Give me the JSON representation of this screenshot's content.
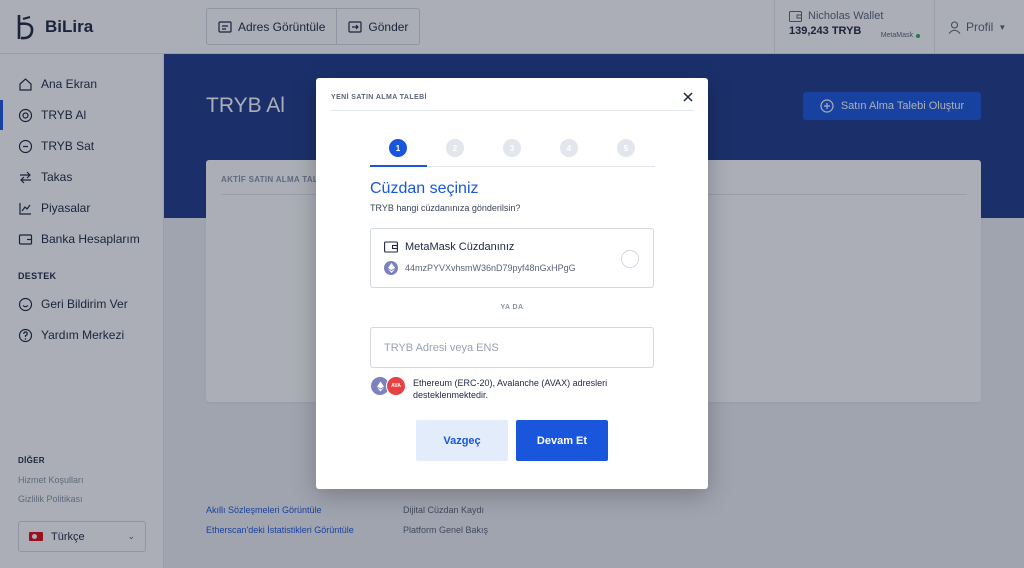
{
  "brand": {
    "name": "BiLira"
  },
  "header": {
    "actions": [
      {
        "label": "Adres Görüntüle",
        "icon": "address-card-icon"
      },
      {
        "label": "Gönder",
        "icon": "send-icon"
      }
    ],
    "wallet": {
      "name": "Nicholas Wallet",
      "balance": "139,243 TRYB",
      "network": "MetaMask",
      "status_color": "#22b35e"
    },
    "profile_label": "Profil"
  },
  "sidebar": {
    "items": [
      {
        "label": "Ana Ekran",
        "icon": "home-icon"
      },
      {
        "label": "TRYB Al",
        "icon": "buy-icon",
        "active": true
      },
      {
        "label": "TRYB Sat",
        "icon": "sell-icon"
      },
      {
        "label": "Takas",
        "icon": "swap-icon"
      },
      {
        "label": "Piyasalar",
        "icon": "chart-icon"
      },
      {
        "label": "Banka Hesaplarım",
        "icon": "wallet-icon"
      }
    ],
    "support_heading": "DESTEK",
    "support_items": [
      {
        "label": "Geri Bildirim Ver",
        "icon": "feedback-icon"
      },
      {
        "label": "Yardım Merkezi",
        "icon": "help-icon"
      }
    ],
    "other_heading": "DİĞER",
    "other_links": [
      "Hizmet Koşulları",
      "Gizlilik Politikası"
    ],
    "language": "Türkçe"
  },
  "main": {
    "title": "TRYB Al",
    "create_button": "Satın Alma Talebi Oluştur",
    "card_heading": "AKTİF SATIN ALMA TAL",
    "footer_left": [
      "Akıllı Sözleşmeleri Görüntüle",
      "Etherscan'deki İstatistikleri Görüntüle"
    ],
    "footer_right": [
      "Dijital Cüzdan Kaydı",
      "Platform Genel Bakış"
    ]
  },
  "modal": {
    "title": "YENİ SATIN ALMA TALEBİ",
    "steps": [
      "1",
      "2",
      "3",
      "4",
      "5"
    ],
    "active_step": 1,
    "heading": "Cüzdan seçiniz",
    "subheading": "TRYB hangi cüzdanınıza gönderilsin?",
    "wallet_option": {
      "name": "MetaMask Cüzdanınız",
      "address": "44mzPYVXvhsmW36nD79pyf48nGxHPgG"
    },
    "or_text": "YA DA",
    "address_input": {
      "value": "",
      "placeholder": "TRYB Adresi veya ENS"
    },
    "chain_note": "Ethereum (ERC-20), Avalanche (AVAX) adresleri desteklenmektedir.",
    "avax_badge": "AVA",
    "cancel_label": "Vazgeç",
    "continue_label": "Devam Et"
  },
  "colors": {
    "accent": "#1a56db",
    "hero": "#1e3a8a",
    "avax": "#e84142",
    "eth": "#7a82c0"
  }
}
